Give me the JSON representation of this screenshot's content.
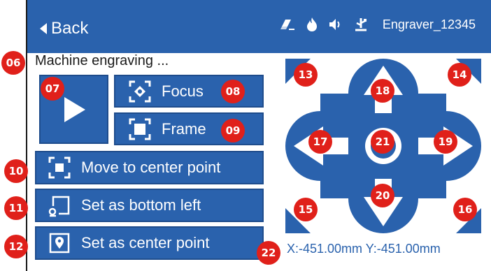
{
  "header": {
    "back_label": "Back",
    "device_name": "Engraver_12345",
    "status_icons": [
      "eraser-icon",
      "flame-icon",
      "speaker-icon",
      "usb-icon"
    ]
  },
  "status_text": "Machine engraving ...",
  "buttons": {
    "focus_label": "Focus",
    "frame_label": "Frame",
    "center_label": "Move to center point",
    "bottom_left_label": "Set as bottom left",
    "set_center_label": "Set as center point"
  },
  "coordinates": "X:-451.00mm  Y:-451.00mm",
  "badges": [
    "06",
    "07",
    "08",
    "09",
    "10",
    "11",
    "12",
    "13",
    "14",
    "15",
    "16",
    "17",
    "18",
    "19",
    "20",
    "21",
    "22"
  ],
  "colors": {
    "primary": "#2a62ad",
    "badge": "#e0201a"
  }
}
